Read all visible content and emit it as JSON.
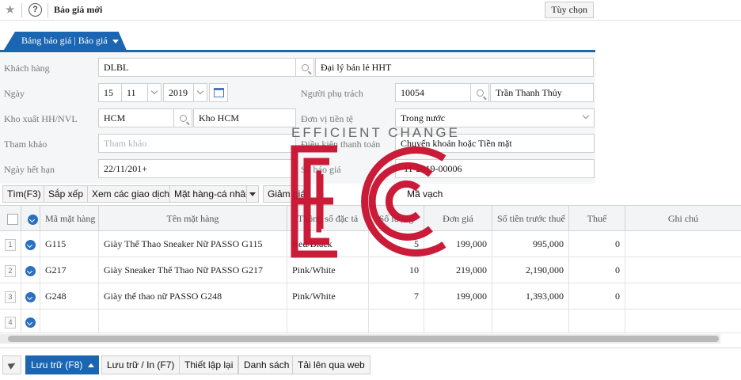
{
  "header": {
    "title": "Báo giá mới",
    "options_label": "Tùy chọn"
  },
  "tab": {
    "label": "Bảng báo giá | Báo giá"
  },
  "form": {
    "customer": {
      "label": "Khách hàng",
      "code": "DLBL",
      "name": "Đại lý bán lẻ HHT"
    },
    "date": {
      "label": "Ngày",
      "day": "15",
      "month": "11",
      "year": "2019"
    },
    "person_in_charge": {
      "label": "Người phụ trách",
      "code": "10054",
      "name": "Trần Thanh Thủy"
    },
    "warehouse": {
      "label": "Kho xuất HH/NVL",
      "code": "HCM",
      "name": "Kho HCM"
    },
    "currency": {
      "label": "Đơn vị tiền tệ",
      "value": "Trong nước"
    },
    "reference": {
      "label": "Tham khảo",
      "placeholder": "Tham khảo"
    },
    "payment_terms": {
      "label": "Điều kiện thanh toán",
      "value": "Chuyển khoản hoặc Tiền mặt"
    },
    "expiry": {
      "label": "Ngày hết hạn",
      "value": "22/11/201+"
    },
    "doc_number": {
      "label": "Số báo giá",
      "value": "-11-2019-00006"
    }
  },
  "toolbar": {
    "find": "Tìm(F3)",
    "sort": "Sắp xếp",
    "view_transactions": "Xem các giao dịch",
    "item_personal": "Mặt hàng-cá nhân",
    "discount": "Giảm giá",
    "scan": "Mã vạch"
  },
  "table": {
    "headers": [
      "Mã mặt hàng",
      "Tên mặt hàng",
      "Thông số đặc tả",
      "Số lượng",
      "Đơn giá",
      "Số tiền trước thuế",
      "Thuế",
      "Ghi chú"
    ],
    "rows": [
      {
        "num": "1",
        "code": "G115",
        "name": "Giày Thể Thao Sneaker Nữ PASSO G115",
        "spec": "Red/Black",
        "qty": "5",
        "price": "199,000",
        "amount": "995,000",
        "tax": "0"
      },
      {
        "num": "2",
        "code": "G217",
        "name": "Giày Sneaker Thể Thao Nữ PASSO G217",
        "spec": "Pink/White",
        "qty": "10",
        "price": "219,000",
        "amount": "2,190,000",
        "tax": "0"
      },
      {
        "num": "3",
        "code": "G248",
        "name": "Giày thể thao nữ PASSO G248",
        "spec": "Pink/White",
        "qty": "7",
        "price": "199,000",
        "amount": "1,393,000",
        "tax": "0"
      },
      {
        "num": "4"
      }
    ]
  },
  "footer": {
    "save": "Lưu trữ (F8)",
    "save_print": "Lưu trữ / In (F7)",
    "reset": "Thiết lập lại",
    "list": "Danh sách",
    "upload": "Tải lên qua web"
  },
  "watermark": {
    "text": "EFFICIENT CHANGE",
    "color": "#c8102e"
  }
}
